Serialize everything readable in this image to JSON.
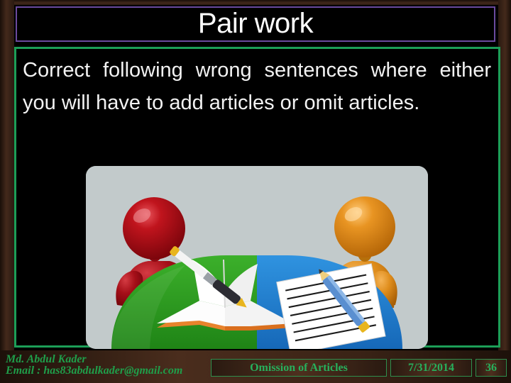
{
  "slide": {
    "title": "Pair work",
    "body_text": "Correct following wrong sentences where either you will have to add articles or omit articles.",
    "colors": {
      "background": "#000000",
      "frame": "#43291b",
      "title_border": "#6b4a9e",
      "body_border": "#1c9e57",
      "title_text": "#ffffff",
      "body_text": "#f2f2f2",
      "footer_text": "#27b05c"
    }
  },
  "illustration": {
    "alt": "Two 3D figures facing each other across a half dome table; book with fountain pen on the green half and lined paper with blue pencil on the blue half",
    "panel_background": "#c2cacb",
    "left_figure_color": "#aa0e16",
    "right_figure_color": "#e08b1a",
    "table_left_color": "#2d9b22",
    "table_right_color": "#1f7fd4",
    "book_cover_color": "#e8832c",
    "pencil_color": "#5a8fd0"
  },
  "footer": {
    "author_name": "Md. Abdul Kader",
    "author_email": "Email : has83abdulkader@gmail.com",
    "subject": "Omission of Articles",
    "date": "7/31/2014",
    "page_number": "36"
  }
}
